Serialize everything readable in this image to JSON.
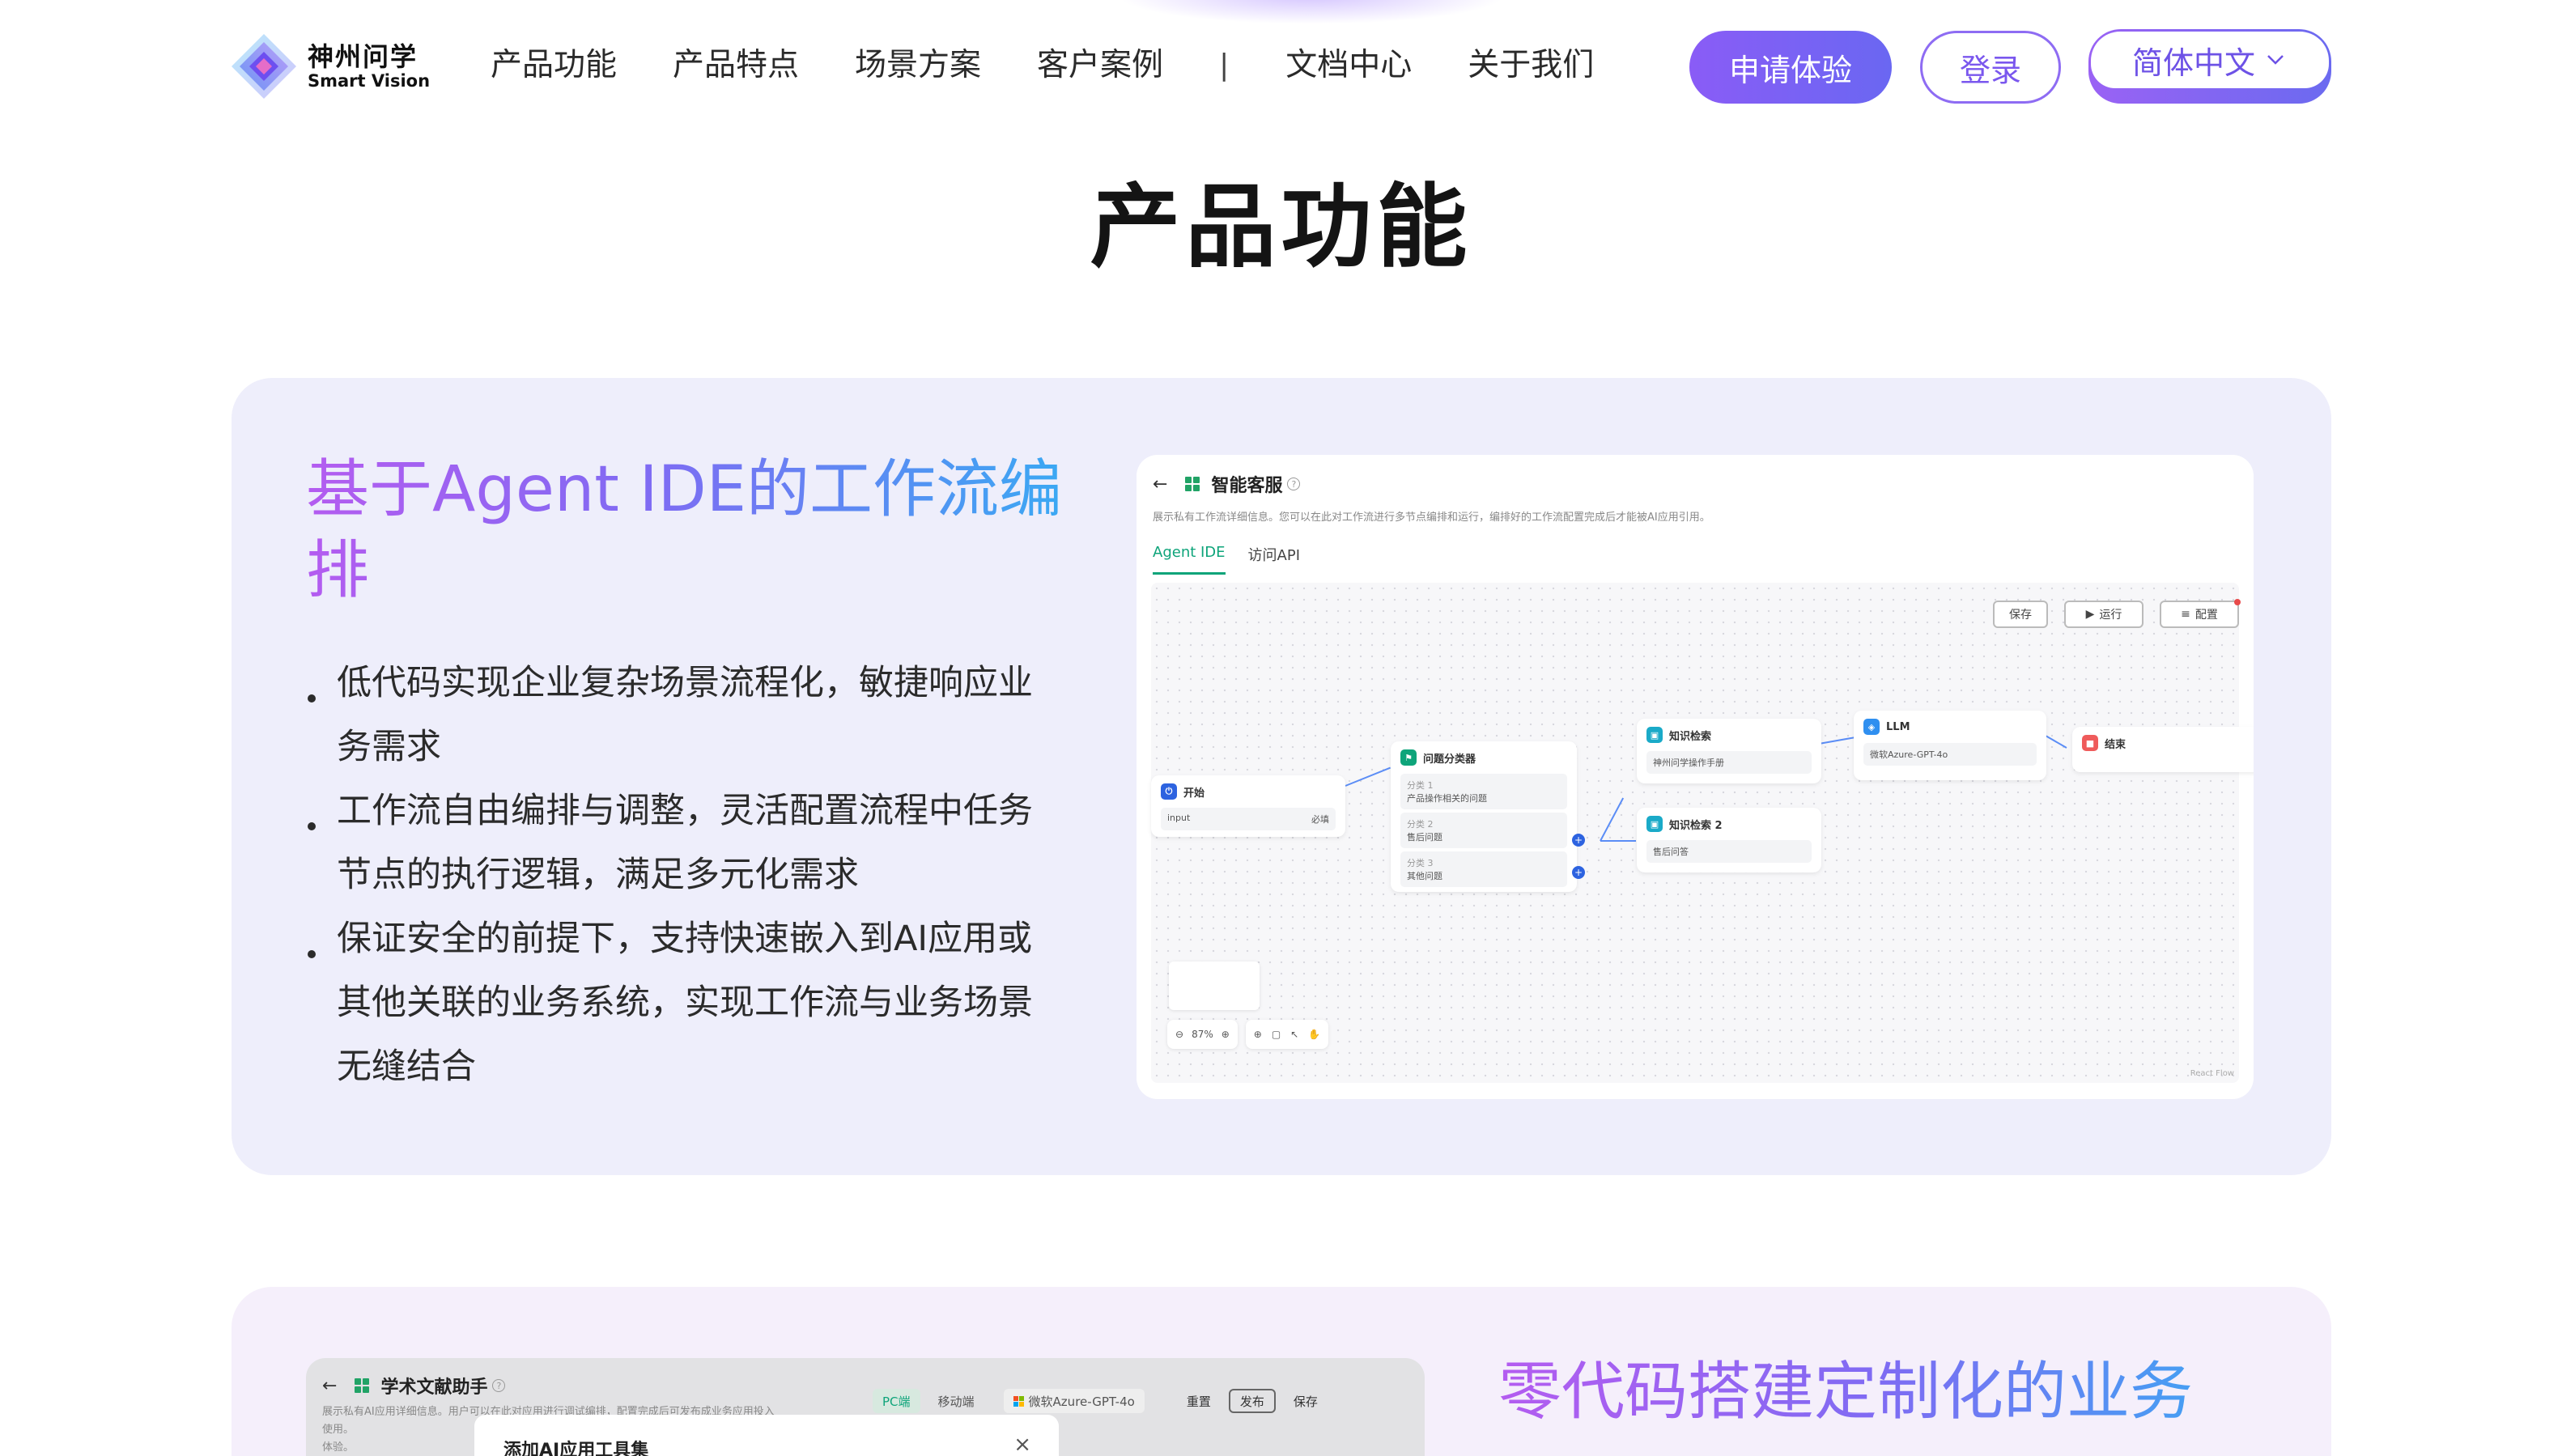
{
  "header": {
    "logo_cn": "神州问学",
    "logo_en": "Smart Vision",
    "nav": [
      "产品功能",
      "产品特点",
      "场景方案",
      "客户案例"
    ],
    "nav_sep": "|",
    "nav2": [
      "文档中心",
      "关于我们"
    ],
    "apply_label": "申请体验",
    "login_label": "登录",
    "lang_label": "简体中文"
  },
  "section_title": "产品功能",
  "feature1": {
    "title": "基于Agent IDE的工作流编排",
    "bullets": [
      "低代码实现企业复杂场景流程化，敏捷响应业务需求",
      "工作流自由编排与调整，灵活配置流程中任务节点的执行逻辑，满足多元化需求",
      "保证安全的前提下，支持快速嵌入到AI应用或其他关联的业务系统，实现工作流与业务场景无缝结合"
    ],
    "mock": {
      "app_name": "智能客服",
      "desc": "展示私有工作流详细信息。您可以在此对工作流进行多节点编排和运行，编排好的工作流配置完成后才能被AI应用引用。",
      "tabs": [
        "Agent IDE",
        "访问API"
      ],
      "toolbar": [
        "保存",
        "运行",
        "配置"
      ],
      "nodes": {
        "start": {
          "title": "开始",
          "row_label": "input",
          "row_tag": "必填"
        },
        "classifier": {
          "title": "问题分类器",
          "rows": [
            [
              "分类 1",
              "产品操作相关的问题"
            ],
            [
              "分类 2",
              "售后问题"
            ],
            [
              "分类 3",
              "其他问题"
            ]
          ]
        },
        "kb1": {
          "title": "知识检索",
          "row": "神州问学操作手册"
        },
        "kb2": {
          "title": "知识检索 2",
          "row": "售后问答"
        },
        "llm": {
          "title": "LLM",
          "row": "微软Azure-GPT-4o"
        },
        "end": {
          "title": "结束"
        }
      },
      "zoom": "87%",
      "footer": "React Flow"
    }
  },
  "feature2": {
    "title": "零代码搭建定制化的业务",
    "mock": {
      "app_name": "学术文献助手",
      "desc": "展示私有AI应用详细信息。用户可以在此对应用进行调试编排，配置完成后可发布成业务应用投入使用。",
      "desc2": "体验。",
      "tabs": [
        "PC端",
        "移动端"
      ],
      "model": "微软Azure-GPT-4o",
      "buttons": [
        "重置",
        "发布",
        "保存"
      ],
      "dialog_title": "添加AI应用工具集"
    }
  },
  "colors": {
    "brand": "#7b5cf3",
    "accent_green": "#0ea47a",
    "edge": "#5b8df6"
  }
}
